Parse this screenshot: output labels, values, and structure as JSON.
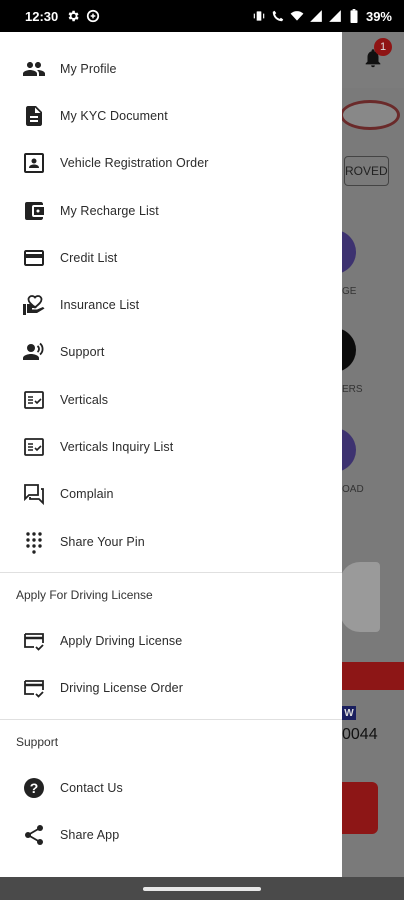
{
  "status_bar": {
    "time": "12:30",
    "battery": "39%"
  },
  "background_app": {
    "notification_count": "1",
    "approved_badge": "ROVED",
    "tile_labels": [
      "GE",
      "ERS",
      "OAD"
    ],
    "wallet_badge": "W",
    "number": "0044"
  },
  "drawer": {
    "menu_items": [
      {
        "label": "My Profile",
        "icon": "people-icon"
      },
      {
        "label": "My KYC Document",
        "icon": "document-icon"
      },
      {
        "label": "Vehicle Registration Order",
        "icon": "registration-icon"
      },
      {
        "label": "My Recharge List",
        "icon": "wallet-icon"
      },
      {
        "label": "Credit List",
        "icon": "credit-card-icon"
      },
      {
        "label": "Insurance List",
        "icon": "insurance-icon"
      },
      {
        "label": "Support",
        "icon": "support-icon"
      },
      {
        "label": "Verticals",
        "icon": "verticals-icon"
      },
      {
        "label": "Verticals Inquiry List",
        "icon": "verticals-inquiry-icon"
      },
      {
        "label": "Complain",
        "icon": "complain-icon"
      },
      {
        "label": "Share Your Pin",
        "icon": "dialpad-icon"
      }
    ],
    "license_section": {
      "title": "Apply For Driving License",
      "items": [
        {
          "label": "Apply Driving License",
          "icon": "license-card-icon"
        },
        {
          "label": "Driving License Order",
          "icon": "license-order-icon"
        }
      ]
    },
    "support_section": {
      "title": "Support",
      "items": [
        {
          "label": "Contact Us",
          "icon": "help-icon"
        },
        {
          "label": "Share App",
          "icon": "share-icon"
        }
      ]
    }
  }
}
